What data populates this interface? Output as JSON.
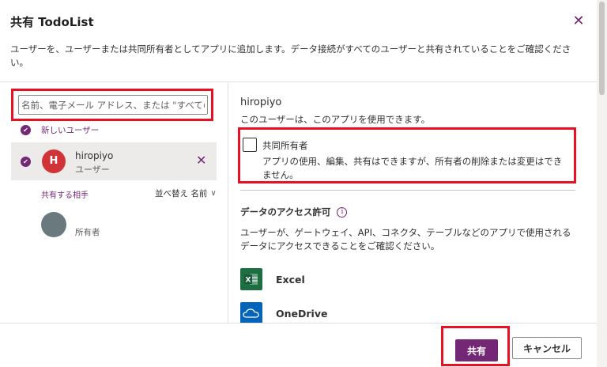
{
  "dialog": {
    "title": "共有 TodoList",
    "close_icon": "close-icon",
    "description": "ユーザーを、ユーザーまたは共同所有者としてアプリに追加します。データ接続がすべてのユーザーと共有されていることをご確認ください。"
  },
  "left": {
    "search": {
      "placeholder": "名前、電子メール アドレス、または \"すべての"
    },
    "new_user_label": "新しいユーザー",
    "selected_user": {
      "initial": "H",
      "name": "hiropiyo",
      "role": "ユーザー",
      "avatar_color": "#d13438"
    },
    "shared_with_label": "共有する相手",
    "sort_label": "並べ替え 名前",
    "owner": {
      "label": "所有者",
      "avatar_color": "#69797e"
    }
  },
  "right": {
    "user_name": "hiropiyo",
    "can_use_text": "このユーザーは、このアプリを使用できます。",
    "coowner": {
      "checked": false,
      "title": "共同所有者",
      "description": "アプリの使用、編集、共有はできますが、所有者の削除または変更はできません。"
    },
    "data_access": {
      "title": "データのアクセス許可",
      "info_icon": "info-icon",
      "description": "ユーザーが、ゲートウェイ、API、コネクタ、テーブルなどのアプリで使用されるデータにアクセスできることをご確認ください。",
      "connections": [
        {
          "name": "Excel",
          "icon": "excel-icon",
          "color": "#1d6f42"
        },
        {
          "name": "OneDrive",
          "icon": "onedrive-icon",
          "color": "#0364b8"
        }
      ]
    }
  },
  "footer": {
    "share_label": "共有",
    "cancel_label": "キャンセル"
  },
  "colors": {
    "accent": "#742774",
    "highlight": "#e81123"
  }
}
